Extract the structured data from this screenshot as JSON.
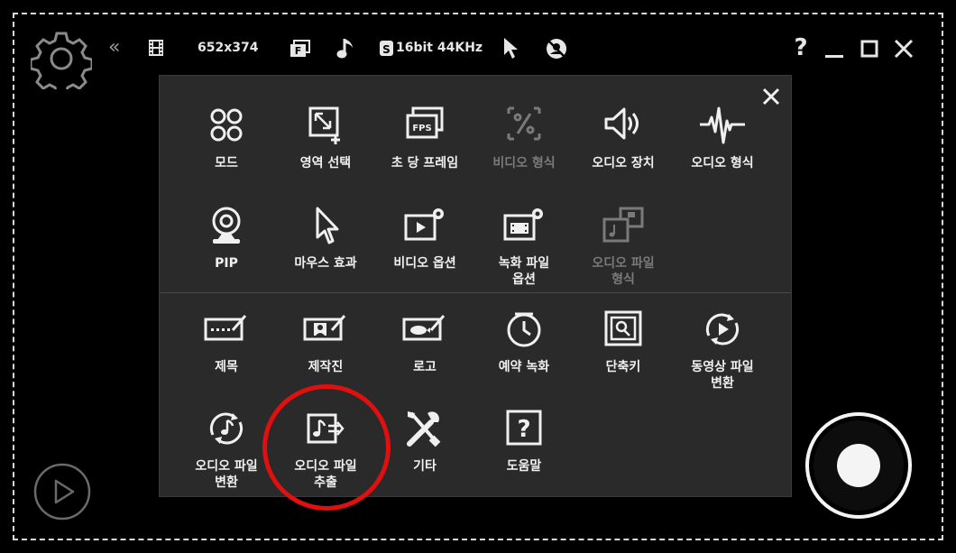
{
  "topbar": {
    "resolution": "652x374",
    "audio_format": "16bit 44KHz",
    "help_label": "?"
  },
  "menu": {
    "row1": [
      {
        "label": "모드",
        "icon": "mode-icon",
        "disabled": false
      },
      {
        "label": "영역 선택",
        "icon": "region-select-icon",
        "disabled": false
      },
      {
        "label": "초 당 프레임",
        "icon": "fps-icon",
        "disabled": false
      },
      {
        "label": "비디오 형식",
        "icon": "video-format-icon",
        "disabled": true
      },
      {
        "label": "오디오 장치",
        "icon": "speaker-icon",
        "disabled": false
      },
      {
        "label": "오디오 형식",
        "icon": "waveform-icon",
        "disabled": false
      }
    ],
    "row2": [
      {
        "label": "PIP",
        "icon": "webcam-icon",
        "disabled": false
      },
      {
        "label": "마우스 효과",
        "icon": "cursor-icon",
        "disabled": false
      },
      {
        "label": "비디오 옵션",
        "icon": "video-settings-icon",
        "disabled": false
      },
      {
        "label": "녹화 파일\n옵션",
        "icon": "record-file-settings-icon",
        "disabled": false
      },
      {
        "label": "오디오 파일\n형식",
        "icon": "audio-file-format-icon",
        "disabled": true
      }
    ],
    "row3": [
      {
        "label": "제목",
        "icon": "title-icon",
        "disabled": false
      },
      {
        "label": "제작진",
        "icon": "credits-icon",
        "disabled": false
      },
      {
        "label": "로고",
        "icon": "logo-icon",
        "disabled": false
      },
      {
        "label": "예약 녹화",
        "icon": "clock-icon",
        "disabled": false
      },
      {
        "label": "단축키",
        "icon": "hotkey-icon",
        "disabled": false
      },
      {
        "label": "동영상 파일\n변환",
        "icon": "video-convert-icon",
        "disabled": false
      }
    ],
    "row4": [
      {
        "label": "오디오 파일\n변환",
        "icon": "audio-convert-icon",
        "disabled": false
      },
      {
        "label": "오디오 파일\n추출",
        "icon": "audio-extract-icon",
        "disabled": false
      },
      {
        "label": "기타",
        "icon": "tools-icon",
        "disabled": false
      },
      {
        "label": "도움말",
        "icon": "help-icon",
        "disabled": false
      }
    ]
  },
  "colors": {
    "background": "#000000",
    "panel": "#2a2a2a",
    "highlight": "#e01010",
    "disabled_text": "#7a7a7a"
  }
}
